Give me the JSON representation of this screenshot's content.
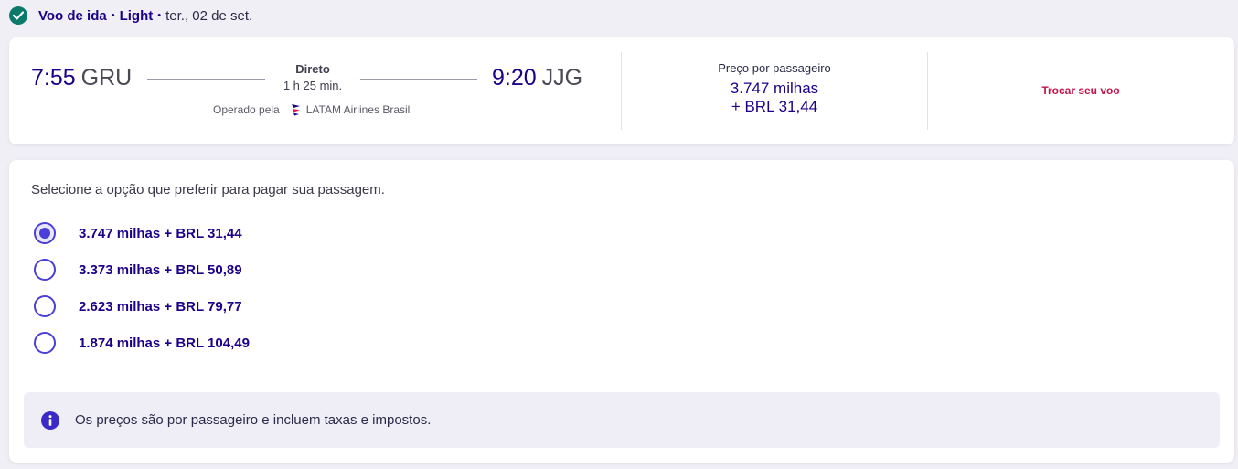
{
  "header": {
    "icon": "check-circle-icon",
    "trip_label": "Voo de ida",
    "separator_1": "•",
    "fare_brand": "Light",
    "separator_2": "•",
    "date": "ter., 02 de set."
  },
  "flight": {
    "departure_time": "7:55",
    "departure_airport": "GRU",
    "arrival_time": "9:20",
    "arrival_airport": "JJG",
    "stops_label": "Direto",
    "duration": "1 h 25 min.",
    "operated_by_label": "Operado pela",
    "airline": "LATAM Airlines Brasil",
    "airline_icon": "latam-logo-icon"
  },
  "price": {
    "title": "Preço por passageiro",
    "miles": "3.747 milhas",
    "cash": "+ BRL 31,44"
  },
  "change_flight_label": "Trocar seu voo",
  "payment": {
    "instruction": "Selecione a opção que preferir para pagar sua passagem.",
    "options": [
      {
        "label": "3.747 milhas + BRL 31,44",
        "selected": true
      },
      {
        "label": "3.373 milhas + BRL 50,89",
        "selected": false
      },
      {
        "label": "2.623 milhas + BRL 79,77",
        "selected": false
      },
      {
        "label": "1.874 milhas + BRL 104,49",
        "selected": false
      }
    ]
  },
  "info": {
    "icon": "info-icon",
    "text": "Os preços são por passageiro e incluem taxas e impostos."
  },
  "colors": {
    "accent": "#1b0088",
    "radio": "#4a3fd6",
    "link": "#c4124a",
    "success": "#0b7a6b",
    "page_background": "#f0eff5"
  }
}
